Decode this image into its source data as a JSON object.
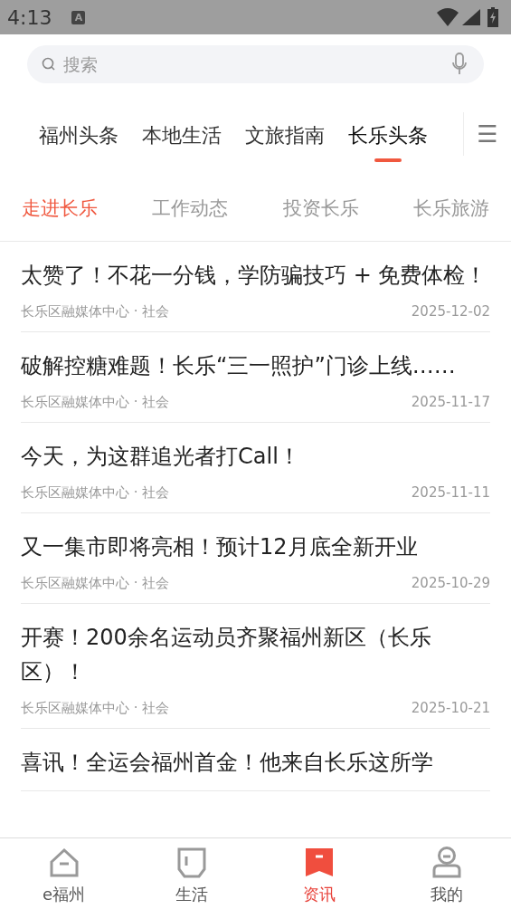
{
  "status_bar": {
    "time": "4:13",
    "notification_badge": "A"
  },
  "search": {
    "placeholder": "搜索"
  },
  "channels": [
    {
      "label": "福州头条",
      "selected": false
    },
    {
      "label": "本地生活",
      "selected": false
    },
    {
      "label": "文旅指南",
      "selected": false
    },
    {
      "label": "长乐头条",
      "selected": true
    }
  ],
  "menu_glyph": "☰",
  "subtabs": [
    {
      "label": "走进长乐",
      "selected": true
    },
    {
      "label": "工作动态",
      "selected": false
    },
    {
      "label": "投资长乐",
      "selected": false
    },
    {
      "label": "长乐旅游",
      "selected": false
    }
  ],
  "articles": [
    {
      "title": "太赞了！不花一分钱，学防骗技巧 + 免费体检！",
      "source": "长乐区融媒体中心 · 社会",
      "date": "2025-12-02"
    },
    {
      "title": "破解控糖难题！长乐“三一照护”门诊上线……",
      "source": "长乐区融媒体中心 · 社会",
      "date": "2025-11-17"
    },
    {
      "title": "今天，为这群追光者打Call！",
      "source": "长乐区融媒体中心 · 社会",
      "date": "2025-11-11"
    },
    {
      "title": "又一集市即将亮相！预计12月底全新开业",
      "source": "长乐区融媒体中心 · 社会",
      "date": "2025-10-29"
    },
    {
      "title": "开赛！200余名运动员齐聚福州新区（长乐区）！",
      "source": "长乐区融媒体中心 · 社会",
      "date": "2025-10-21"
    },
    {
      "title": "喜讯！全运会福州首金！他来自长乐这所学"
    }
  ],
  "bottom_nav": [
    {
      "label": "e福州",
      "kind": "home",
      "selected": false
    },
    {
      "label": "生活",
      "kind": "pocket",
      "selected": false
    },
    {
      "label": "资讯",
      "kind": "bookmark",
      "selected": true
    },
    {
      "label": "我的",
      "kind": "person",
      "selected": false
    }
  ]
}
